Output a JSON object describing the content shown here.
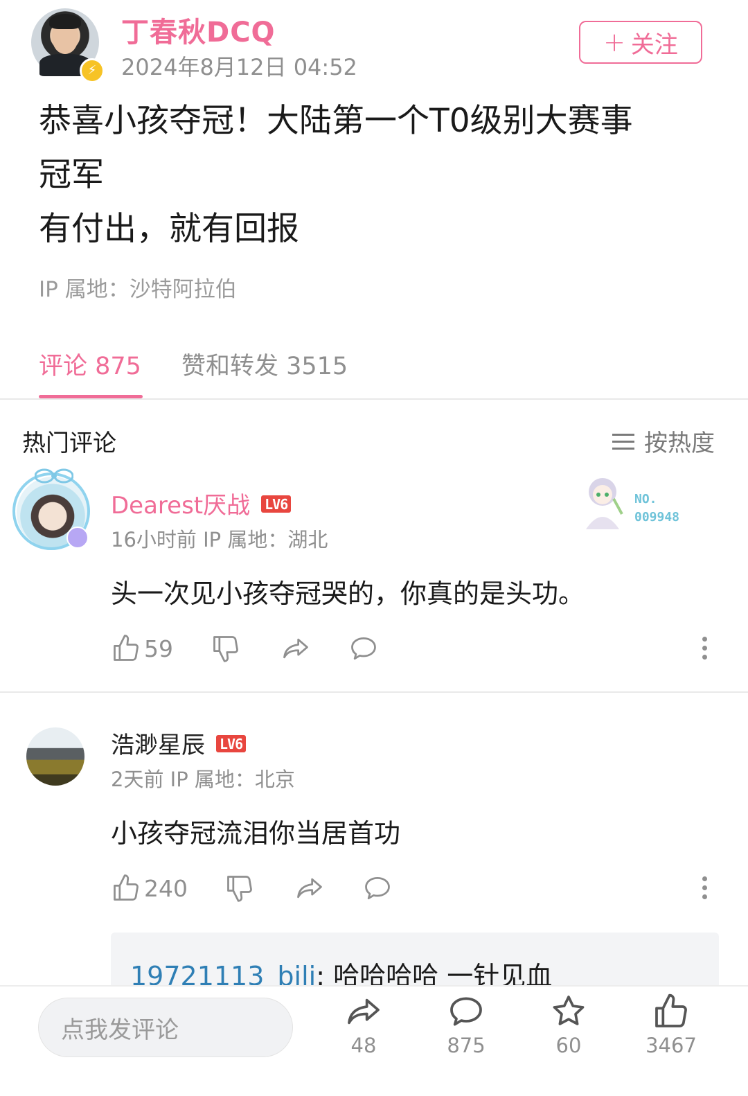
{
  "post": {
    "author": "丁春秋DCQ",
    "timestamp": "2024年8月12日 04:52",
    "follow_label": "关注",
    "follow_plus": "+",
    "text_lines": [
      "恭喜小孩夺冠！大陆第一个T0级别大赛事",
      "冠军",
      "有付出，就有回报"
    ],
    "ip": "IP 属地：沙特阿拉伯"
  },
  "tabs": [
    {
      "label": "评论 875",
      "active": true
    },
    {
      "label": "赞和转发 3515",
      "active": false
    }
  ],
  "hot_section": {
    "title": "热门评论",
    "sort_label": "按热度"
  },
  "comments": [
    {
      "username": "Dearest厌战",
      "level": "LV6",
      "meta": "16小时前  IP 属地：湖北",
      "text": "头一次见小孩夺冠哭的，你真的是头功。",
      "likes": "59",
      "fan_badge_no": "NO.",
      "fan_badge_num": "009948"
    },
    {
      "username": "浩渺星辰",
      "level": "LV6",
      "meta": "2天前  IP 属地：北京",
      "text": "小孩夺冠流泪你当居首功",
      "likes": "240",
      "reply": {
        "user": "19721113_bili",
        "sep": ":",
        "text": " 哈哈哈哈 一针见血"
      }
    }
  ],
  "bottom_bar": {
    "input_placeholder": "点我发评论",
    "share_count": "48",
    "comment_count": "875",
    "favorite_count": "60",
    "like_count": "3467"
  },
  "colors": {
    "accent": "#f06c97",
    "level_badge": "#e8463f",
    "link": "#2f7fb5",
    "verified": "#f7c325"
  }
}
